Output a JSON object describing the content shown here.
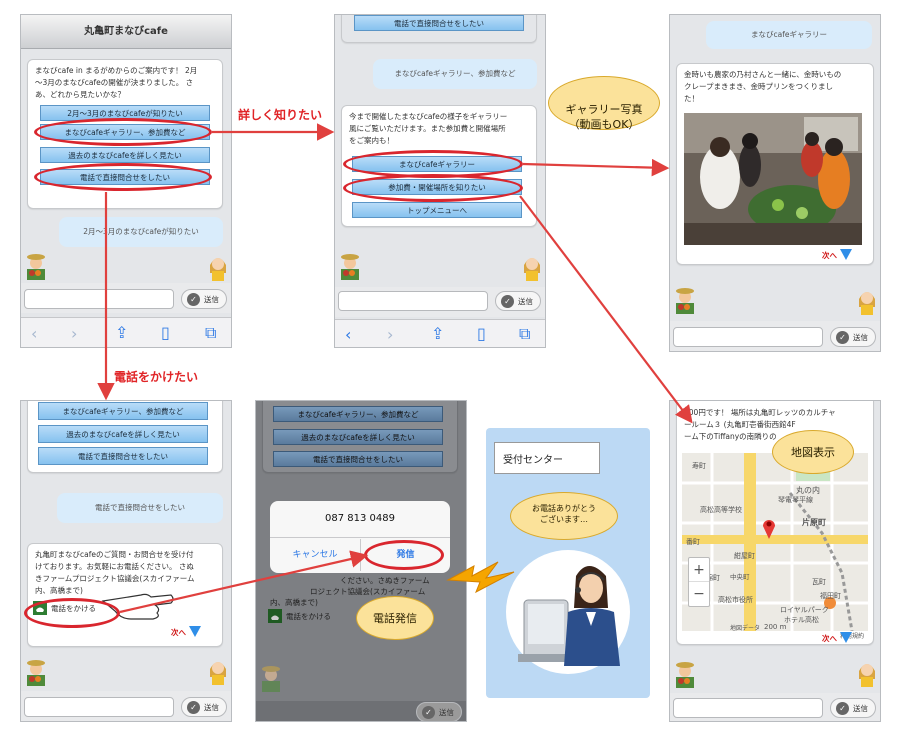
{
  "screen1": {
    "title": "丸亀町まなびcafe",
    "message_line1": "まなびcafe in まるがめからのご案内です！ 2月",
    "message_line2": "～3月のまなびcafeの開催が決まりました。 さ",
    "message_line3": "あ、どれから見たいかな？",
    "buttons": [
      "2月～3月のまなびcafeが知りたい",
      "まなびcafeギャラリー、参加費など",
      "過去のまなびcafeを詳しく見たい",
      "電話で直接問合せをしたい"
    ],
    "user_bubble": "2月～3月のまなびcafeが知りたい",
    "send_label": "送信"
  },
  "screen2": {
    "top_button": "電話で直接問合せをしたい",
    "user_bubble": "まなびcafeギャラリー、参加費など",
    "message_line1": "今まで開催したまなびcafeの様子をギャラリー",
    "message_line2": "風にご覧いただけます。また参加費と開催場所",
    "message_line3": "をご案内も！",
    "buttons": [
      "まなびcafeギャラリー",
      "参加費・開催場所を知りたい",
      "トップメニューへ"
    ],
    "send_label": "送信"
  },
  "screen3": {
    "user_bubble": "まなびcafeギャラリー",
    "message_line1": "金時いも農家の乃村さんと一緒に、金時いもの",
    "message_line2": "クレープまきまき、金時プリンをつくりまし",
    "message_line3": "た！",
    "next_label": "次へ",
    "send_label": "送信"
  },
  "screen4": {
    "buttons": [
      "まなびcafeギャラリー、参加費など",
      "過去のまなびcafeを詳しく見たい",
      "電話で直接問合せをしたい"
    ],
    "user_bubble": "電話で直接問合せをしたい",
    "message_line1": "丸亀町まなびcafeのご質問・お問合せを受け付",
    "message_line2": "けております。お気軽にお電話ください。 さぬ",
    "message_line3": "きファームプロジェクト協議会(スカイファーム",
    "message_line4": "内、高橋まで)",
    "call_label": "電話をかける",
    "next_label": "次へ",
    "send_label": "送信"
  },
  "screen5": {
    "buttons": [
      "まなびcafeギャラリー、参加費など",
      "過去のまなびcafeを詳しく見たい",
      "電話で直接問合せをしたい"
    ],
    "phone_number": "087 813 0489",
    "cancel_label": "キャンセル",
    "call_label": "発信",
    "bg_text_line1": "内、高橋まで)",
    "bg_text_line2": "ください。さぬきファーム",
    "bg_text_line3": "ロジェクト協議会(スカイファーム",
    "call_button_label": "電話をかける",
    "send_label": "送信"
  },
  "screen6": {
    "message_line1": "000円です！ 場所は丸亀町レッツのカルチャ",
    "message_line2": "ールーム３ (丸亀町壱番街西館4F",
    "message_line3": "ーム下のTiffanyの南隣りの",
    "map_labels": [
      "寿町",
      "丸の内",
      "高松高等学校",
      "片原町",
      "瓦町",
      "福田町",
      "番町",
      "紺屋町",
      "錦町",
      "高松市役所",
      "ホテル高松",
      "ロイヤルパーク",
      "琴電琴平線",
      "200 m",
      "地図データ",
      "利用規約",
      "中央町"
    ],
    "zoom_in": "+",
    "zoom_out": "−",
    "next_label": "次へ",
    "send_label": "送信"
  },
  "callouts": {
    "gallery": "ギャラリー写真\n（動画もOK）",
    "map": "地図表示",
    "dial": "電話発信",
    "center_speech_line1": "お電話ありがとう",
    "center_speech_line2": "ございます…"
  },
  "labels": {
    "more_detail": "詳しく知りたい",
    "call_want": "電話をかけたい",
    "reception": "受付センター"
  },
  "colors": {
    "arrow": "#e0403e",
    "button_blue": "#9fd0f5",
    "ring_red": "#d9262e",
    "callout_yellow": "#fbe29a",
    "panel_blue": "#bcd9f4"
  }
}
